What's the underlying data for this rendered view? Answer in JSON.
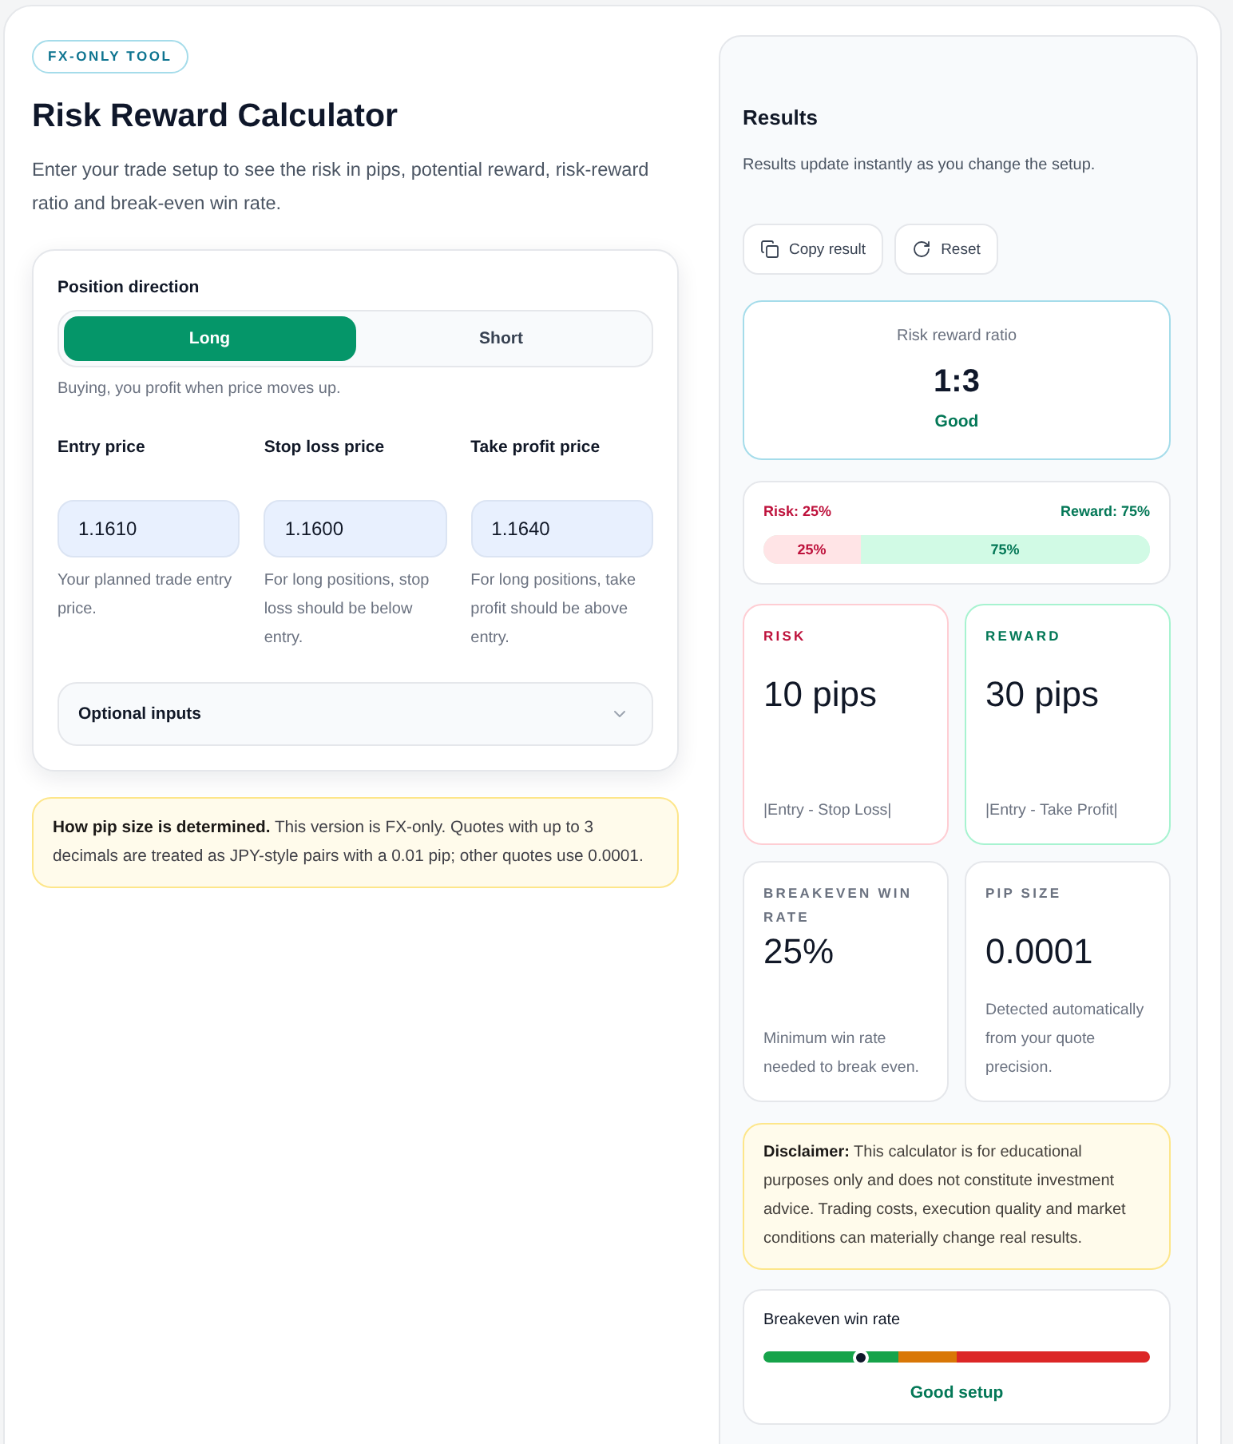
{
  "badge": "FX-ONLY TOOL",
  "title": "Risk Reward Calculator",
  "description": "Enter your trade setup to see the risk in pips, potential reward, risk-reward ratio and break-even win rate.",
  "setup": {
    "direction": {
      "label": "Position direction",
      "options": [
        {
          "label": "Long",
          "selected": true
        },
        {
          "label": "Short",
          "selected": false
        }
      ],
      "help": "Buying, you profit when price moves up."
    },
    "fields": [
      {
        "label": "Entry price",
        "value": "1.1610",
        "help": "Your planned trade entry price."
      },
      {
        "label": "Stop loss price",
        "value": "1.1600",
        "help": "For long positions, stop loss should be below entry."
      },
      {
        "label": "Take profit price",
        "value": "1.1640",
        "help": "For long positions, take profit should be above entry."
      }
    ],
    "optional_inputs": {
      "label": "Optional inputs",
      "expanded": false
    }
  },
  "pip_note": "**How pip size is determined.** This version is FX-only. Quotes with up to 3 decimals are treated as JPY-style pairs with a 0.01 pip; other quotes use 0.0001.",
  "results": {
    "title": "Results",
    "subtitle": "Results update instantly as you change the setup.",
    "actions": [
      {
        "kind": "copy",
        "label": "Copy result"
      },
      {
        "kind": "reset",
        "label": "Reset"
      }
    ],
    "ratio": {
      "label": "Risk reward ratio",
      "value": "1:3",
      "rating": "Good"
    },
    "split": {
      "risk_label": "Risk: 25%",
      "reward_label": "Reward: 75%",
      "risk_share": "25%",
      "reward_share": "75%",
      "level": 0.25
    },
    "metrics": [
      {
        "kind": "risk",
        "label": "RISK",
        "value": "10 pips",
        "note": "|Entry - Stop Loss|"
      },
      {
        "kind": "reward",
        "label": "REWARD",
        "value": "30 pips",
        "note": "|Entry - Take Profit|"
      },
      {
        "kind": "neutral",
        "label": "BREAKEVEN WIN RATE",
        "value": "25%",
        "note": "Minimum win rate needed to break even."
      },
      {
        "kind": "neutral",
        "label": "PIP SIZE",
        "value": "0.0001",
        "note": "Detected automatically from your quote precision."
      }
    ],
    "disclaimer": "**Disclaimer:** This calculator is for educational purposes only and does not constitute investment advice. Trading costs, execution quality and market conditions can materially change real results.",
    "gauge": {
      "label": "Breakeven win rate",
      "level": 0.25,
      "verdict": "Good setup"
    }
  }
}
